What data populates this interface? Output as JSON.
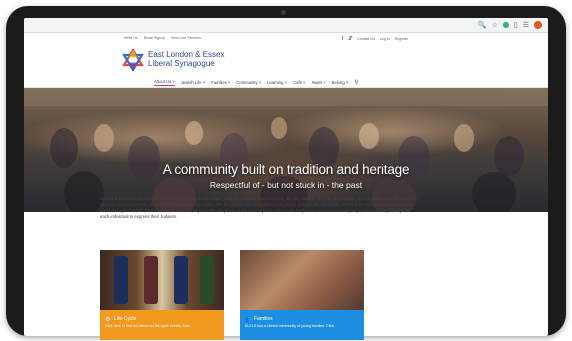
{
  "browser": {
    "extension_icons": [
      "search-icon",
      "star-icon",
      "green-dot",
      "puzzle-icon",
      "bookmark-icon"
    ],
    "avatar_color": "#e8541c"
  },
  "topbar": {
    "left_links": [
      "Write Us",
      "Email Signup",
      "View Live Services"
    ],
    "right_links": [
      "Contact Us",
      "Log in",
      "Register"
    ]
  },
  "logo": {
    "line1": "East London & Essex",
    "line2": "Liberal Synagogue",
    "brand_color": "#2e4a99"
  },
  "nav": {
    "items": [
      "About Us",
      "Jewish Life",
      "Families",
      "Community",
      "Learning",
      "Cafe",
      "News",
      "Belong"
    ],
    "active": "About Us"
  },
  "hero": {
    "title": "A community built on tradition and heritage",
    "subtitle": "Respectful of - but not stuck in - the past"
  },
  "intro": {
    "text": "ELELS is a community as well as a congregation. We are single, married, widowed and divorced. We are LGBTQ, and we are straight. We are single parents, interfaith families, coupled parents, Jews by birth and Jews by choice. We are people with disabilities and people without. We are locally based in Redbridge, and living further afield throughout North East London, Essex and beyond. We are proud of the diversity and strive to be responsive to our community to provide a variety of ways for each individual to express their Judaism."
  },
  "cards": [
    {
      "title": "Life-Cycle",
      "desc": "Click here to find out about our life-cycle events, from",
      "color": "#f29a1f",
      "icon": "gear-icon"
    },
    {
      "title": "Families",
      "desc": "ELELS has a vibrant community of young families. Click",
      "color": "#1e8fe0",
      "icon": "people-icon"
    }
  ]
}
